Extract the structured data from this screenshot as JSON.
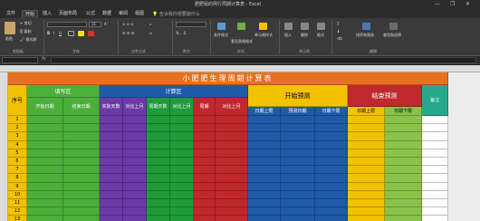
{
  "window": {
    "title": "肥肥姐的例行周期计算表 - Excel",
    "minimize": "—",
    "restore": "❐",
    "close": "✕"
  },
  "ribbon_tabs": [
    "文件",
    "开始",
    "插入",
    "页面布局",
    "公式",
    "数据",
    "审阅",
    "视图",
    "帮助"
  ],
  "active_tab": "开始",
  "tell_me": "告诉我你想要做什么",
  "ribbon": {
    "paste": "粘贴",
    "cut": "剪切",
    "copy": "复制",
    "format_painter": "格式刷",
    "clipboard": "剪贴板",
    "font": "字体",
    "font_size": "11",
    "alignment": "对齐方式",
    "number": "数字",
    "conditional_format": "条件格式",
    "table_format": "套用表格格式",
    "cell_styles": "单元格样式",
    "styles": "样式",
    "insert": "插入",
    "delete": "删除",
    "format": "格式",
    "cells": "单元格",
    "sort_filter": "排序和筛选",
    "find_select": "查找和选择",
    "editing": "编辑"
  },
  "formula_bar": {
    "fx": "fx"
  },
  "sheet": {
    "title": "小肥肥生理周期计算表",
    "section_input": "填写区",
    "section_calc": "计算区",
    "section_start_predict": "开始预测",
    "section_end_predict": "结束预测",
    "seq_label": "序号",
    "headers": [
      "开始日期",
      "结束日期",
      "实际天数",
      "对比上月",
      "周期天数",
      "对比上月",
      "周期",
      "对比上月",
      "日期上限",
      "预测日期",
      "日期下限",
      "日期上限",
      "日期下限",
      "备注"
    ],
    "row_numbers": [
      "1",
      "2",
      "3",
      "4",
      "5",
      "6",
      "7",
      "8",
      "9",
      "10",
      "11",
      "12",
      "13"
    ]
  },
  "colors": {
    "orange_band": "#e8711f",
    "input_green": "#4caf3a",
    "calc_purple": "#6a3aa8",
    "calc_green": "#1f9b3a",
    "cycle_red": "#c0282e",
    "blue_predict": "#1f5aa8",
    "gold": "#f2c200",
    "lime": "#8bc34a",
    "teal": "#27a88a"
  }
}
